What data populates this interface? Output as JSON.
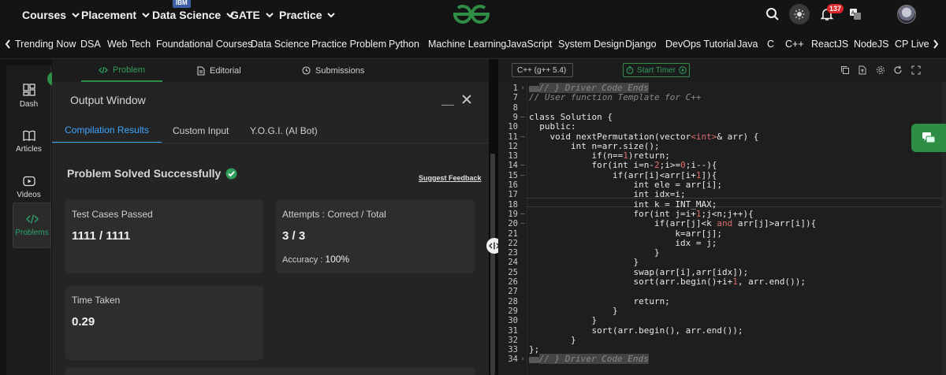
{
  "topnav": {
    "items": [
      {
        "label": "Courses"
      },
      {
        "label": "Placement"
      },
      {
        "label": "Data Science",
        "badge": "IBM"
      },
      {
        "label": "GATE"
      },
      {
        "label": "Practice"
      }
    ],
    "notification_count": "137",
    "brand_color": "#2f8d46"
  },
  "subnav": {
    "items": [
      "Trending Now",
      "DSA",
      "Web Tech",
      "Foundational Courses",
      "Data Science",
      "Practice Problem",
      "Python",
      "Machine Learning",
      "JavaScript",
      "System Design",
      "Django",
      "DevOps Tutorial",
      "Java",
      "C",
      "C++",
      "ReactJS",
      "NodeJS",
      "CP Live"
    ]
  },
  "sidebar": {
    "items": [
      {
        "label": "Dash",
        "icon": "dashboard-icon"
      },
      {
        "label": "Articles",
        "icon": "book-icon"
      },
      {
        "label": "Videos",
        "icon": "video-icon"
      },
      {
        "label": "Problems",
        "icon": "code-icon",
        "active": true
      }
    ]
  },
  "problem_tabs": [
    {
      "label": "Problem",
      "active": true
    },
    {
      "label": "Editorial"
    },
    {
      "label": "Submissions"
    }
  ],
  "output": {
    "title": "Output Window",
    "minimize": "__",
    "tabs": [
      {
        "label": "Compilation Results",
        "active": true
      },
      {
        "label": "Custom Input"
      },
      {
        "label": "Y.O.G.I. (AI Bot)"
      }
    ],
    "status": "Problem Solved Successfully",
    "feedback_link": "Suggest Feedback",
    "test_cases": {
      "label": "Test Cases Passed",
      "value": "1111 / 1111"
    },
    "attempts": {
      "label": "Attempts : Correct / Total",
      "value": "3 / 3",
      "accuracy_label": "Accuracy : ",
      "accuracy_value": "100%"
    },
    "time": {
      "label": "Time Taken",
      "value": "0.29"
    }
  },
  "editor": {
    "language": "C++ (g++ 5.4)",
    "timer_label": "Start Timer",
    "current_line": 15,
    "lines": [
      {
        "n": "1",
        "mark": "›",
        "segs": [
          {
            "t": "...",
            "c": "fold"
          },
          {
            "t": "// } Driver Code Ends",
            "c": "cm hl"
          }
        ]
      },
      {
        "n": "7",
        "mark": "",
        "segs": [
          {
            "t": "// User function Template for C++",
            "c": "cm"
          }
        ]
      },
      {
        "n": "8",
        "mark": "",
        "segs": [
          {
            "t": "",
            "c": ""
          }
        ]
      },
      {
        "n": "9",
        "mark": "–",
        "segs": [
          {
            "t": "class Solution {",
            "c": ""
          }
        ]
      },
      {
        "n": "10",
        "mark": "",
        "segs": [
          {
            "t": "  public:",
            "c": ""
          }
        ]
      },
      {
        "n": "11",
        "mark": "–",
        "segs": [
          {
            "t": "    void nextPermutation(vector",
            "c": ""
          },
          {
            "t": "<int>",
            "c": "red"
          },
          {
            "t": "& arr) {",
            "c": ""
          }
        ]
      },
      {
        "n": "12",
        "mark": "",
        "segs": [
          {
            "t": "        int n=arr.size();",
            "c": ""
          }
        ]
      },
      {
        "n": "13",
        "mark": "",
        "segs": [
          {
            "t": "            if(n==",
            "c": ""
          },
          {
            "t": "1",
            "c": "red"
          },
          {
            "t": ")return;",
            "c": ""
          }
        ]
      },
      {
        "n": "14",
        "mark": "–",
        "segs": [
          {
            "t": "            for(int i=n-",
            "c": ""
          },
          {
            "t": "2",
            "c": "red"
          },
          {
            "t": ";i>=",
            "c": ""
          },
          {
            "t": "0",
            "c": "red"
          },
          {
            "t": ";i--){",
            "c": ""
          }
        ]
      },
      {
        "n": "15",
        "mark": "–",
        "segs": [
          {
            "t": "                if(arr[i]<arr[i+",
            "c": ""
          },
          {
            "t": "1",
            "c": "red"
          },
          {
            "t": "]){",
            "c": ""
          }
        ]
      },
      {
        "n": "16",
        "mark": "",
        "segs": [
          {
            "t": "                    int ele = arr[i];",
            "c": ""
          }
        ]
      },
      {
        "n": "17",
        "mark": "",
        "segs": [
          {
            "t": "                    int idx=i;",
            "c": ""
          }
        ]
      },
      {
        "n": "18",
        "mark": "",
        "segs": [
          {
            "t": "                    int k = INT_MAX;",
            "c": ""
          }
        ]
      },
      {
        "n": "19",
        "mark": "–",
        "segs": [
          {
            "t": "                    for(int j=i+",
            "c": ""
          },
          {
            "t": "1",
            "c": "red"
          },
          {
            "t": ";j<n;j++){",
            "c": ""
          }
        ]
      },
      {
        "n": "20",
        "mark": "–",
        "segs": [
          {
            "t": "                        if(arr[j]<k ",
            "c": ""
          },
          {
            "t": "and",
            "c": "red"
          },
          {
            "t": " arr[j]>arr[i]){",
            "c": ""
          }
        ]
      },
      {
        "n": "21",
        "mark": "",
        "segs": [
          {
            "t": "                            k=arr[j];",
            "c": ""
          }
        ]
      },
      {
        "n": "22",
        "mark": "",
        "segs": [
          {
            "t": "                            idx = j;",
            "c": ""
          }
        ]
      },
      {
        "n": "23",
        "mark": "",
        "segs": [
          {
            "t": "                        }",
            "c": ""
          }
        ]
      },
      {
        "n": "24",
        "mark": "",
        "segs": [
          {
            "t": "                    }",
            "c": ""
          }
        ]
      },
      {
        "n": "25",
        "mark": "",
        "segs": [
          {
            "t": "                    swap(arr[i],arr[idx]);",
            "c": ""
          }
        ]
      },
      {
        "n": "26",
        "mark": "",
        "segs": [
          {
            "t": "                    sort(arr.begin()+i+",
            "c": ""
          },
          {
            "t": "1",
            "c": "red"
          },
          {
            "t": ", arr.end());",
            "c": ""
          }
        ]
      },
      {
        "n": "27",
        "mark": "",
        "segs": [
          {
            "t": "",
            "c": ""
          }
        ]
      },
      {
        "n": "28",
        "mark": "",
        "segs": [
          {
            "t": "                    return;",
            "c": ""
          }
        ]
      },
      {
        "n": "29",
        "mark": "",
        "segs": [
          {
            "t": "                }",
            "c": ""
          }
        ]
      },
      {
        "n": "30",
        "mark": "",
        "segs": [
          {
            "t": "            }",
            "c": ""
          }
        ]
      },
      {
        "n": "31",
        "mark": "",
        "segs": [
          {
            "t": "            sort(arr.begin(), arr.end());",
            "c": ""
          }
        ]
      },
      {
        "n": "32",
        "mark": "",
        "segs": [
          {
            "t": "        }",
            "c": ""
          }
        ]
      },
      {
        "n": "33",
        "mark": "",
        "segs": [
          {
            "t": "};",
            "c": ""
          }
        ]
      },
      {
        "n": "34",
        "mark": "›",
        "segs": [
          {
            "t": "...",
            "c": "fold"
          },
          {
            "t": "// } Driver Code Ends",
            "c": "cm hl"
          }
        ]
      }
    ]
  }
}
